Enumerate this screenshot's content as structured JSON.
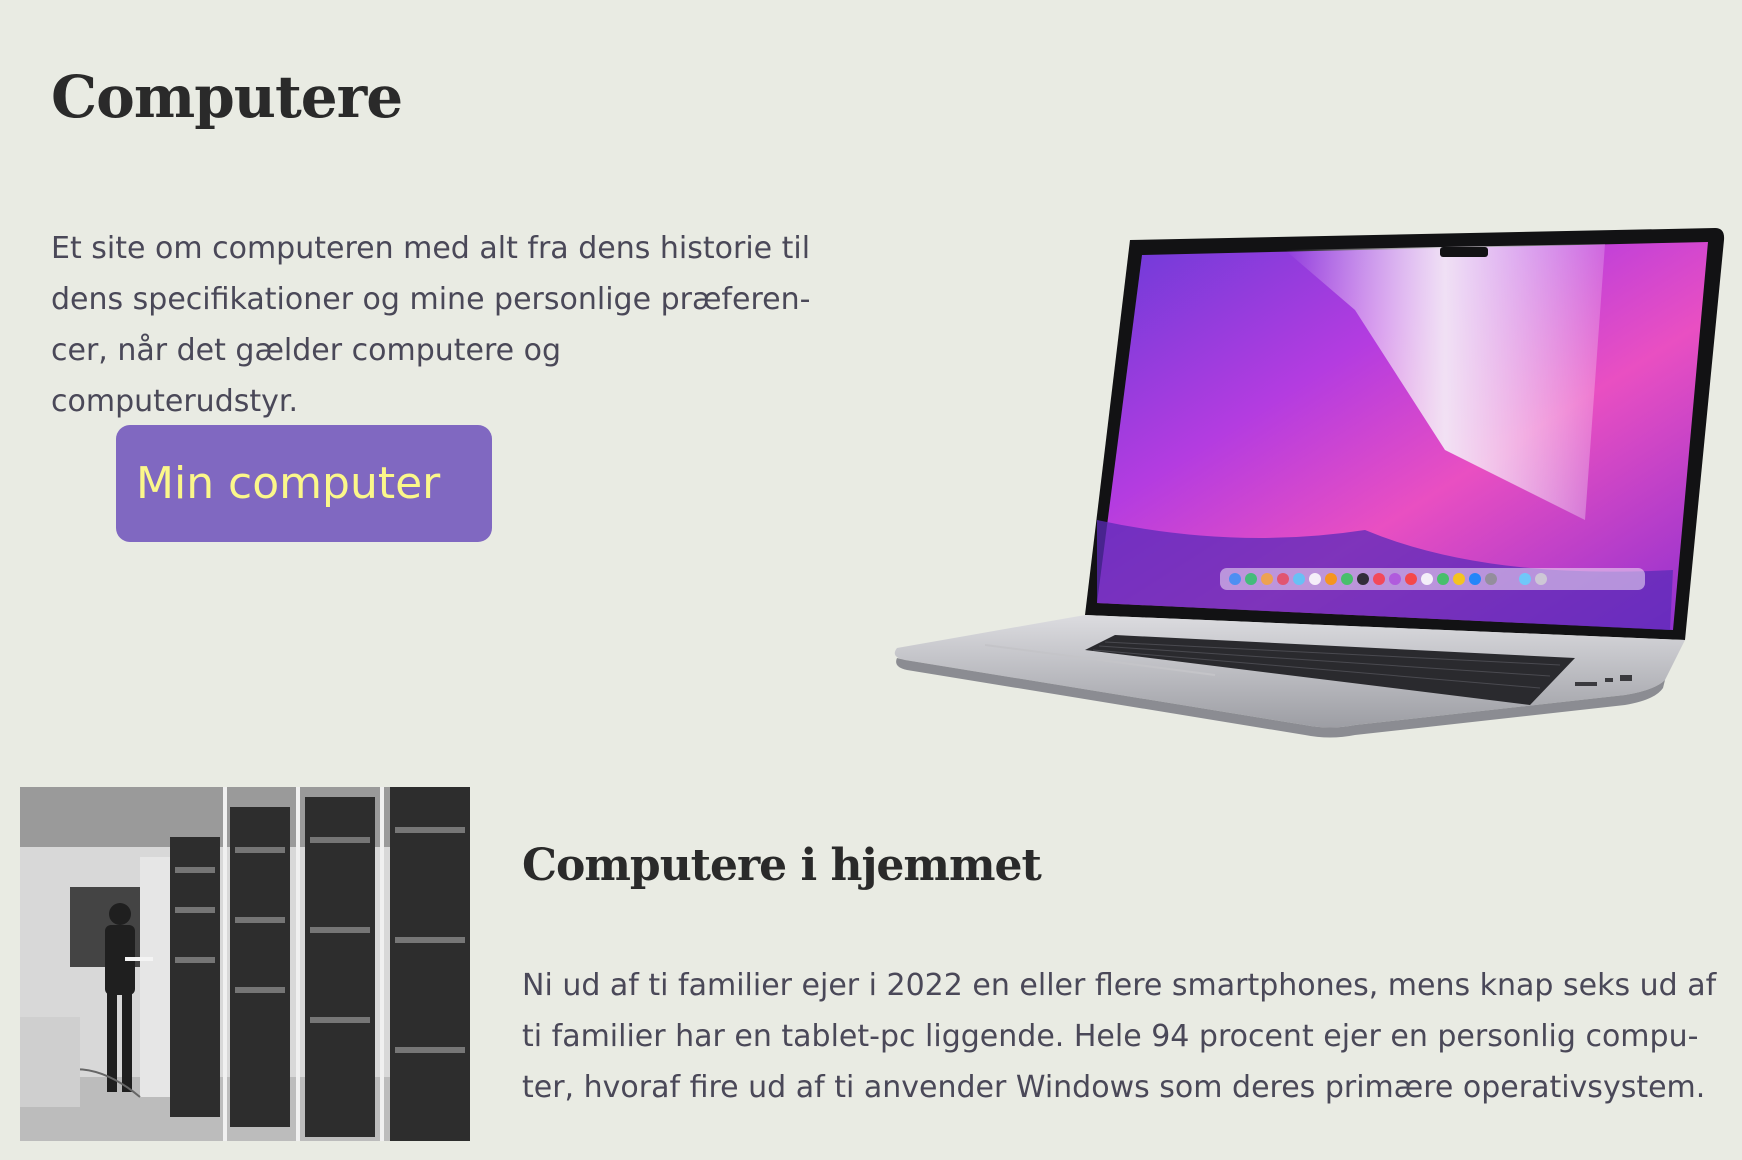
{
  "hero": {
    "title": "Computere",
    "intro": "Et site om computeren med alt fra dens historie til dens specifikationer og mine personlige præferen-cer, når det gælder computere og computerudstyr.",
    "cta_label": "Min computer",
    "accent_color": "#8068c1",
    "cta_text_color": "#fbf78a"
  },
  "section": {
    "heading": "Computere i hjemmet",
    "body": "Ni ud af ti familier ejer i 2022 en eller flere smartphones, mens knap seks ud af ti familier har en tablet-pc liggende. Hele 94 procent ejer en personlig compu-ter, hvoraf fire ud af ti anvender Windows som deres primære operativsystem."
  },
  "images": {
    "laptop": "laptop-photo",
    "historic": "historic-computer-photo"
  }
}
